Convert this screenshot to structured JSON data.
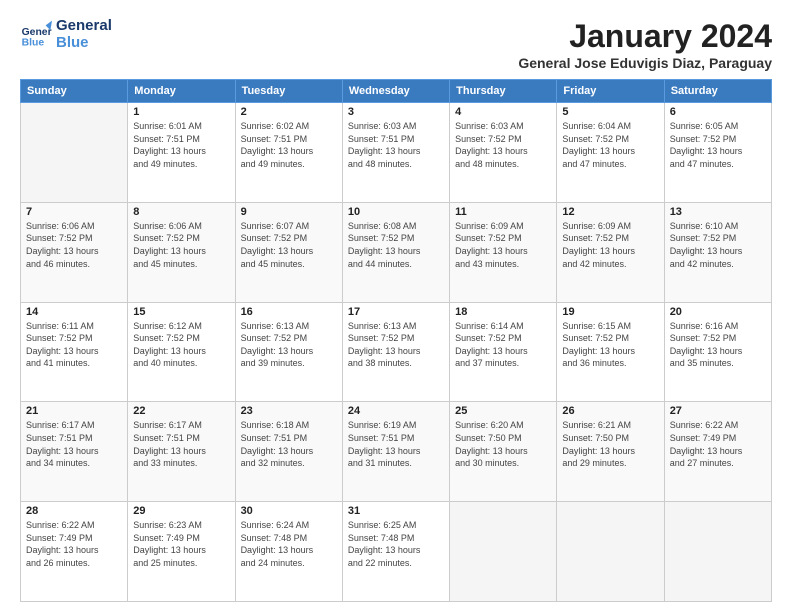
{
  "header": {
    "logo_general": "General",
    "logo_blue": "Blue",
    "month_title": "January 2024",
    "subtitle": "General Jose Eduvigis Diaz, Paraguay"
  },
  "days_of_week": [
    "Sunday",
    "Monday",
    "Tuesday",
    "Wednesday",
    "Thursday",
    "Friday",
    "Saturday"
  ],
  "weeks": [
    [
      {
        "day": "",
        "info": ""
      },
      {
        "day": "1",
        "info": "Sunrise: 6:01 AM\nSunset: 7:51 PM\nDaylight: 13 hours\nand 49 minutes."
      },
      {
        "day": "2",
        "info": "Sunrise: 6:02 AM\nSunset: 7:51 PM\nDaylight: 13 hours\nand 49 minutes."
      },
      {
        "day": "3",
        "info": "Sunrise: 6:03 AM\nSunset: 7:51 PM\nDaylight: 13 hours\nand 48 minutes."
      },
      {
        "day": "4",
        "info": "Sunrise: 6:03 AM\nSunset: 7:52 PM\nDaylight: 13 hours\nand 48 minutes."
      },
      {
        "day": "5",
        "info": "Sunrise: 6:04 AM\nSunset: 7:52 PM\nDaylight: 13 hours\nand 47 minutes."
      },
      {
        "day": "6",
        "info": "Sunrise: 6:05 AM\nSunset: 7:52 PM\nDaylight: 13 hours\nand 47 minutes."
      }
    ],
    [
      {
        "day": "7",
        "info": "Sunrise: 6:06 AM\nSunset: 7:52 PM\nDaylight: 13 hours\nand 46 minutes."
      },
      {
        "day": "8",
        "info": "Sunrise: 6:06 AM\nSunset: 7:52 PM\nDaylight: 13 hours\nand 45 minutes."
      },
      {
        "day": "9",
        "info": "Sunrise: 6:07 AM\nSunset: 7:52 PM\nDaylight: 13 hours\nand 45 minutes."
      },
      {
        "day": "10",
        "info": "Sunrise: 6:08 AM\nSunset: 7:52 PM\nDaylight: 13 hours\nand 44 minutes."
      },
      {
        "day": "11",
        "info": "Sunrise: 6:09 AM\nSunset: 7:52 PM\nDaylight: 13 hours\nand 43 minutes."
      },
      {
        "day": "12",
        "info": "Sunrise: 6:09 AM\nSunset: 7:52 PM\nDaylight: 13 hours\nand 42 minutes."
      },
      {
        "day": "13",
        "info": "Sunrise: 6:10 AM\nSunset: 7:52 PM\nDaylight: 13 hours\nand 42 minutes."
      }
    ],
    [
      {
        "day": "14",
        "info": "Sunrise: 6:11 AM\nSunset: 7:52 PM\nDaylight: 13 hours\nand 41 minutes."
      },
      {
        "day": "15",
        "info": "Sunrise: 6:12 AM\nSunset: 7:52 PM\nDaylight: 13 hours\nand 40 minutes."
      },
      {
        "day": "16",
        "info": "Sunrise: 6:13 AM\nSunset: 7:52 PM\nDaylight: 13 hours\nand 39 minutes."
      },
      {
        "day": "17",
        "info": "Sunrise: 6:13 AM\nSunset: 7:52 PM\nDaylight: 13 hours\nand 38 minutes."
      },
      {
        "day": "18",
        "info": "Sunrise: 6:14 AM\nSunset: 7:52 PM\nDaylight: 13 hours\nand 37 minutes."
      },
      {
        "day": "19",
        "info": "Sunrise: 6:15 AM\nSunset: 7:52 PM\nDaylight: 13 hours\nand 36 minutes."
      },
      {
        "day": "20",
        "info": "Sunrise: 6:16 AM\nSunset: 7:52 PM\nDaylight: 13 hours\nand 35 minutes."
      }
    ],
    [
      {
        "day": "21",
        "info": "Sunrise: 6:17 AM\nSunset: 7:51 PM\nDaylight: 13 hours\nand 34 minutes."
      },
      {
        "day": "22",
        "info": "Sunrise: 6:17 AM\nSunset: 7:51 PM\nDaylight: 13 hours\nand 33 minutes."
      },
      {
        "day": "23",
        "info": "Sunrise: 6:18 AM\nSunset: 7:51 PM\nDaylight: 13 hours\nand 32 minutes."
      },
      {
        "day": "24",
        "info": "Sunrise: 6:19 AM\nSunset: 7:51 PM\nDaylight: 13 hours\nand 31 minutes."
      },
      {
        "day": "25",
        "info": "Sunrise: 6:20 AM\nSunset: 7:50 PM\nDaylight: 13 hours\nand 30 minutes."
      },
      {
        "day": "26",
        "info": "Sunrise: 6:21 AM\nSunset: 7:50 PM\nDaylight: 13 hours\nand 29 minutes."
      },
      {
        "day": "27",
        "info": "Sunrise: 6:22 AM\nSunset: 7:49 PM\nDaylight: 13 hours\nand 27 minutes."
      }
    ],
    [
      {
        "day": "28",
        "info": "Sunrise: 6:22 AM\nSunset: 7:49 PM\nDaylight: 13 hours\nand 26 minutes."
      },
      {
        "day": "29",
        "info": "Sunrise: 6:23 AM\nSunset: 7:49 PM\nDaylight: 13 hours\nand 25 minutes."
      },
      {
        "day": "30",
        "info": "Sunrise: 6:24 AM\nSunset: 7:48 PM\nDaylight: 13 hours\nand 24 minutes."
      },
      {
        "day": "31",
        "info": "Sunrise: 6:25 AM\nSunset: 7:48 PM\nDaylight: 13 hours\nand 22 minutes."
      },
      {
        "day": "",
        "info": ""
      },
      {
        "day": "",
        "info": ""
      },
      {
        "day": "",
        "info": ""
      }
    ]
  ]
}
